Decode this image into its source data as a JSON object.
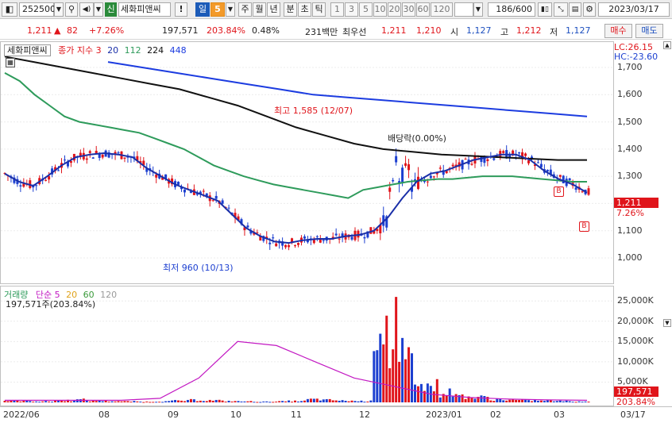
{
  "toolbar": {
    "code": "252500",
    "badge": "신",
    "stock_name": "세화피앤씨",
    "excl": "!",
    "period": "일",
    "period_num": "5",
    "periods": [
      "주",
      "월",
      "년",
      "분",
      "초",
      "틱"
    ],
    "minutes": [
      "1",
      "3",
      "5",
      "10",
      "20",
      "30",
      "60",
      "120"
    ],
    "count": "186/600",
    "date": "2023/03/17"
  },
  "info": {
    "price": "1,211",
    "change_arrow": "▲",
    "change": "82",
    "change_pct": "+7.26%",
    "volume": "197,571",
    "vol_pct": "203.84%",
    "turnover": "0.48%",
    "amount": "231백만",
    "best_label": "최우선",
    "ask": "1,211",
    "bid": "1,210",
    "open_label": "시",
    "open": "1,127",
    "high_label": "고",
    "high": "1,212",
    "low_label": "저",
    "low": "1,127",
    "buy": "매수",
    "sell": "매도"
  },
  "price_legend": {
    "name": "세화피앤씨",
    "ind": "종가 지수 3",
    "ma": [
      "20",
      "112",
      "224",
      "448"
    ]
  },
  "volume_legend": {
    "name": "거래량",
    "ind": "단순 5",
    "ma": [
      "20",
      "60",
      "120"
    ],
    "value": "197,571주(203.84%)"
  },
  "axis": {
    "lc": "LC:26.15",
    "hc": "HC:-23.60",
    "price_ticks": [
      "1,700",
      "1,600",
      "1,500",
      "1,400",
      "1,300",
      "1,200",
      "1,100",
      "1,000"
    ],
    "cur_price": "1,211",
    "cur_pct": "7.26%",
    "vol_ticks": [
      "25,000K",
      "20,000K",
      "15,000K",
      "10,000K",
      "5,000K"
    ],
    "cur_vol": "197,571",
    "cur_vol_pct": "203.84%"
  },
  "annotations": {
    "high": "최고 1,585 (12/07)",
    "low": "최저 960 (10/13)",
    "dividend": "배당락(0.00%)",
    "b_marker": "B"
  },
  "x_labels": [
    "2022/06",
    "08",
    "09",
    "10",
    "11",
    "12",
    "2023/01",
    "02",
    "03",
    "03/17"
  ],
  "colors": {
    "up": "#e0151b",
    "down": "#1c3fd0",
    "ma20": "#1a2fa8",
    "ma112": "#2e9b5b",
    "ma224": "#111111",
    "ma448": "#1c3ce0",
    "vma5": "#c218c2",
    "vma20": "#e0a21a",
    "vma60": "#3a9a3a",
    "vma120": "#9a9a9a"
  },
  "chart_data": {
    "type": "candlestick",
    "ylim": [
      930,
      1770
    ],
    "high": 1585,
    "low": 960,
    "last": 1211,
    "ma20": [
      1310,
      1280,
      1265,
      1300,
      1340,
      1370,
      1380,
      1385,
      1380,
      1370,
      1330,
      1300,
      1270,
      1250,
      1230,
      1210,
      1160,
      1110,
      1080,
      1060,
      1055,
      1065,
      1070,
      1070,
      1080,
      1085,
      1100,
      1150,
      1220,
      1280,
      1310,
      1320,
      1340,
      1360,
      1370,
      1380,
      1380,
      1360,
      1320,
      1290,
      1270,
      1240
    ],
    "ma112": [
      1680,
      1650,
      1600,
      1560,
      1520,
      1500,
      1490,
      1480,
      1470,
      1460,
      1440,
      1420,
      1400,
      1370,
      1340,
      1320,
      1300,
      1285,
      1270,
      1260,
      1250,
      1240,
      1230,
      1220,
      1250,
      1260,
      1270,
      1280,
      1285,
      1290,
      1290,
      1295,
      1300,
      1300,
      1300,
      1295,
      1290,
      1285,
      1280,
      1280
    ],
    "ma224": [
      1740,
      1720,
      1700,
      1680,
      1660,
      1640,
      1620,
      1590,
      1560,
      1520,
      1480,
      1450,
      1420,
      1400,
      1390,
      1380,
      1375,
      1370,
      1365,
      1360,
      1360
    ],
    "ma448": [
      1720,
      1700,
      1680,
      1660,
      1640,
      1620,
      1600,
      1590,
      1580,
      1570,
      1560,
      1550,
      1540,
      1530,
      1520
    ],
    "volume_k": [
      500,
      400,
      300,
      600,
      800,
      500,
      400,
      300,
      200,
      300,
      500,
      700,
      600,
      400,
      300,
      200,
      300,
      400,
      900,
      700,
      500,
      400,
      26000,
      15000,
      9000,
      5000,
      3000,
      2000,
      1500,
      900,
      700,
      600,
      500,
      400,
      300,
      200
    ],
    "vma5": [
      500,
      500,
      500,
      500,
      1000,
      6000,
      15000,
      14000,
      10000,
      6000,
      4000,
      2000,
      1200,
      800,
      600,
      500
    ]
  }
}
